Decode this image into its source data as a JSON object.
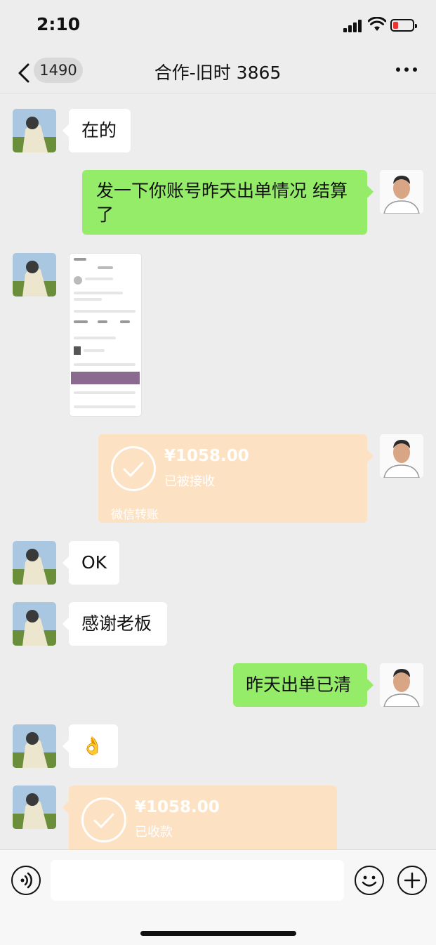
{
  "status": {
    "time": "2:10"
  },
  "nav": {
    "unread": "1490",
    "title": "合作-旧时 3865"
  },
  "messages": {
    "m1": "在的",
    "m2": "发一下你账号昨天出单情况 结算了",
    "t1": {
      "amount": "¥1058.00",
      "status": "已被接收",
      "label": "微信转账"
    },
    "m4": "OK",
    "m5": "感谢老板",
    "m6": "昨天出单已清",
    "m7": "👌",
    "t2": {
      "amount": "¥1058.00",
      "status": "已收款"
    }
  },
  "colors": {
    "green_bubble": "#95ec69",
    "transfer": "#fde1c3"
  }
}
